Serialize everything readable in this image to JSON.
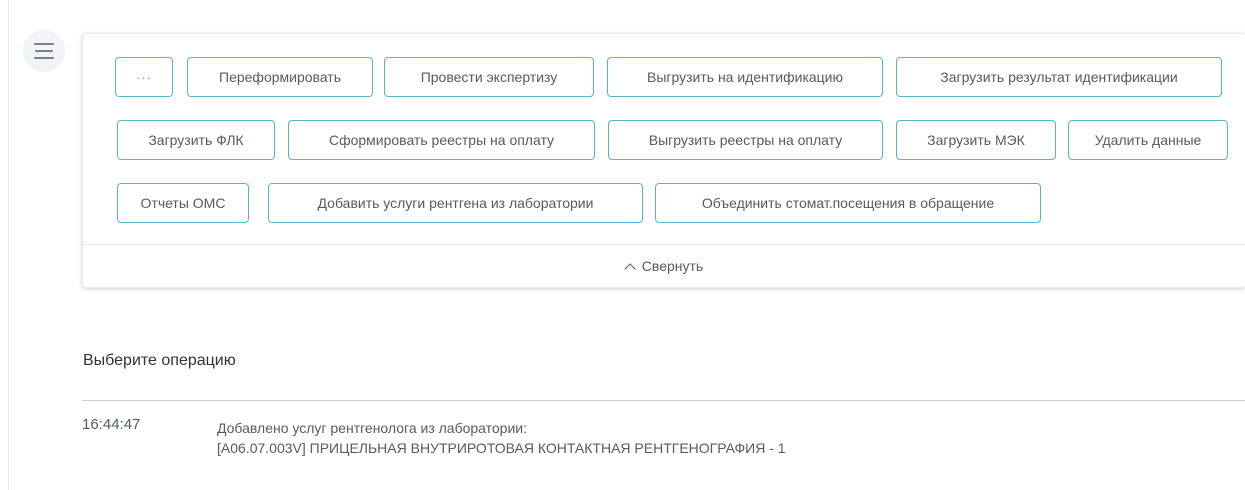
{
  "menu": {
    "icon": "hamburger-menu-icon"
  },
  "toolbar": {
    "more_label": "···",
    "buttons": [
      "Переформировать",
      "Провести экспертизу",
      "Выгрузить на идентификацию",
      "Загрузить результат идентификации",
      "Загрузить ФЛК",
      "Сформировать реестры на оплату",
      "Выгрузить реестры на оплату",
      "Загрузить МЭК",
      "Удалить данные",
      "Отчеты ОМС",
      "Добавить услуги рентгена из лаборатории",
      "Объединить стомат.посещения в обращение"
    ],
    "collapse_label": "Свернуть",
    "collapse_icon": "chevron-up-icon",
    "accent_color": "#56b6c9"
  },
  "operation": {
    "title": "Выберите операцию",
    "log": [
      {
        "time": "16:44:47",
        "line1": "Добавлено услуг рентгенолога из лаборатории:",
        "line2": "[A06.07.003V] ПРИЦЕЛЬНАЯ ВНУТРИРОТОВАЯ КОНТАКТНАЯ РЕНТГЕНОГРАФИЯ - 1"
      }
    ]
  }
}
